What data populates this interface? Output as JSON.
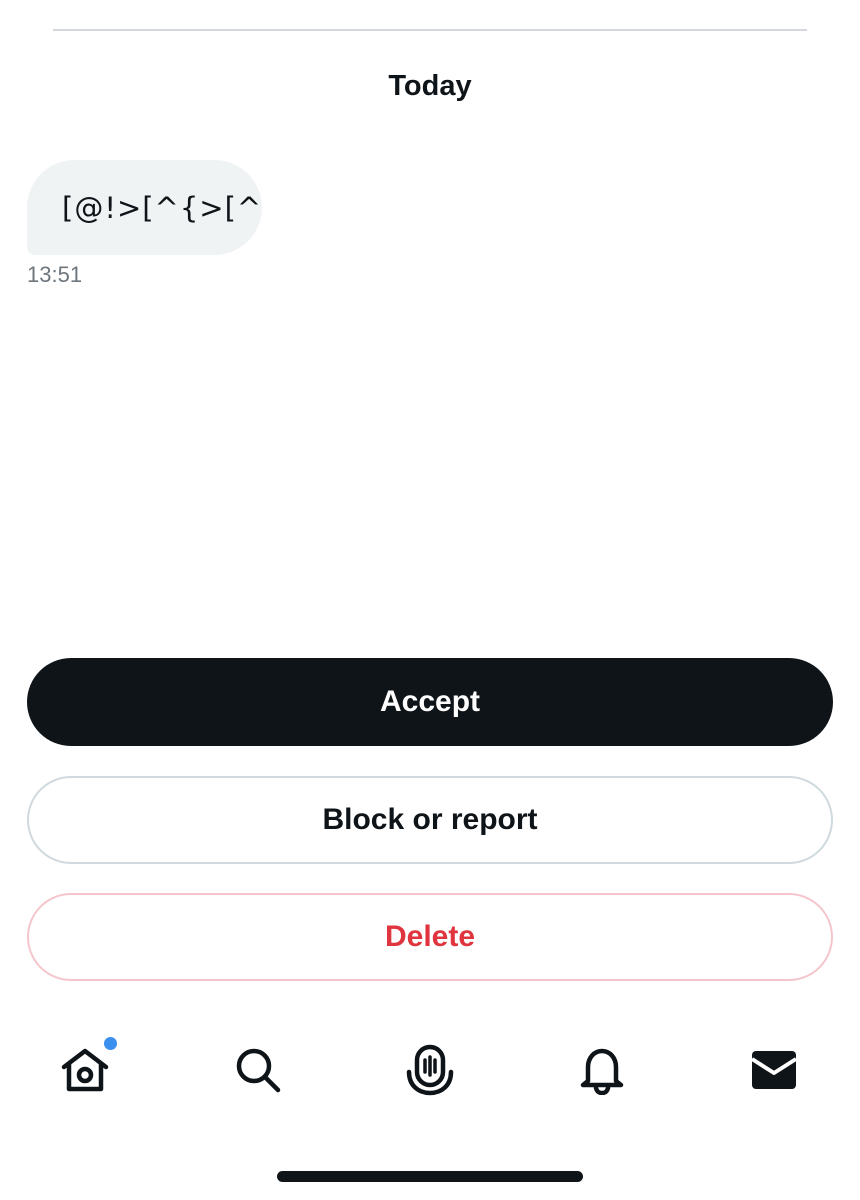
{
  "conversation": {
    "date_separator": "Today",
    "messages": [
      {
        "text": "[@!>[^{>[^",
        "time": "13:51",
        "direction": "incoming"
      }
    ]
  },
  "actions": {
    "accept_label": "Accept",
    "block_label": "Block or report",
    "delete_label": "Delete"
  },
  "tabbar": {
    "items": [
      {
        "name": "home",
        "icon": "home-icon",
        "has_notification_dot": true,
        "active": false
      },
      {
        "name": "search",
        "icon": "search-icon",
        "active": false
      },
      {
        "name": "spaces",
        "icon": "spaces-microphone-icon",
        "active": false
      },
      {
        "name": "notifications",
        "icon": "bell-icon",
        "active": false
      },
      {
        "name": "messages",
        "icon": "envelope-icon",
        "active": true
      }
    ]
  },
  "colors": {
    "primary_text": "#0f1419",
    "secondary_text": "#6e767d",
    "bubble_bg": "#eff3f4",
    "danger": "#e0353e",
    "notification_dot": "#3b8fef"
  }
}
